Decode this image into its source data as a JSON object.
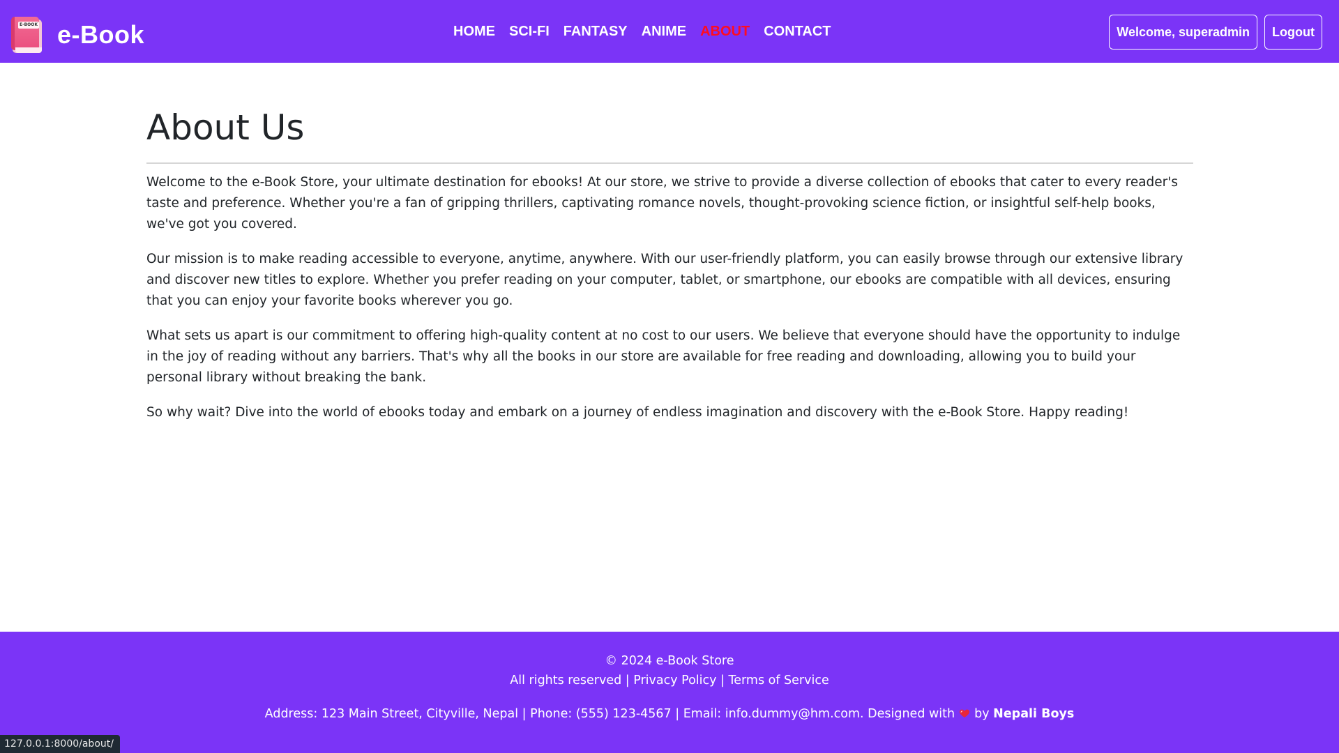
{
  "brand": {
    "name": "e-Book",
    "logo_label": "E-BOOK",
    "logo_icon": "book-icon"
  },
  "nav": {
    "items": [
      {
        "label": "HOME",
        "active": false
      },
      {
        "label": "SCI-FI",
        "active": false
      },
      {
        "label": "FANTASY",
        "active": false
      },
      {
        "label": "ANIME",
        "active": false
      },
      {
        "label": "ABOUT",
        "active": true
      },
      {
        "label": "CONTACT",
        "active": false
      }
    ],
    "welcome_label": "Welcome, superadmin",
    "logout_label": "Logout"
  },
  "main": {
    "title": "About Us",
    "paragraphs": [
      "Welcome to the e-Book Store, your ultimate destination for ebooks! At our store, we strive to provide a diverse collection of ebooks that cater to every reader's taste and preference. Whether you're a fan of gripping thrillers, captivating romance novels, thought-provoking science fiction, or insightful self-help books, we've got you covered.",
      "Our mission is to make reading accessible to everyone, anytime, anywhere. With our user-friendly platform, you can easily browse through our extensive library and discover new titles to explore. Whether you prefer reading on your computer, tablet, or smartphone, our ebooks are compatible with all devices, ensuring that you can enjoy your favorite books wherever you go.",
      "What sets us apart is our commitment to offering high-quality content at no cost to our users. We believe that everyone should have the opportunity to indulge in the joy of reading without any barriers. That's why all the books in our store are available for free reading and downloading, allowing you to build your personal library without breaking the bank.",
      "So why wait? Dive into the world of ebooks today and embark on a journey of endless imagination and discovery with the e-Book Store. Happy reading!"
    ]
  },
  "footer": {
    "copyright": "© 2024 e-Book Store",
    "rights": "All rights reserved",
    "separator": " | ",
    "privacy_label": "Privacy Policy",
    "terms_label": "Terms of Service",
    "contact_line": "Address: 123 Main Street, Cityville, Nepal | Phone: (555) 123-4567 | Email: info.dummy@hm.com. Designed with",
    "by_label": "by",
    "credit": "Nepali Boys",
    "heart_icon": "heart-icon"
  },
  "status_bar": {
    "url": "127.0.0.1:8000/about/"
  },
  "colors": {
    "primary": "#7b34f7",
    "active_nav": "#ff0d1f",
    "text": "#212529",
    "heart": "#e8263b"
  }
}
